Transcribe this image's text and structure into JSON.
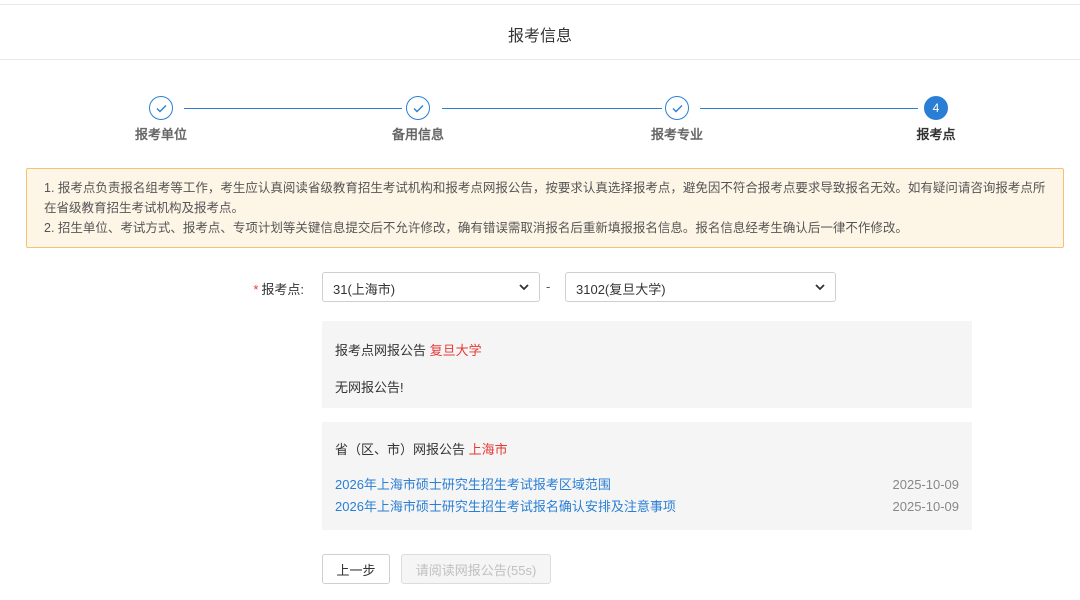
{
  "header": {
    "title": "报考信息"
  },
  "steps": [
    {
      "label": "报考单位",
      "status": "done",
      "icon": "check-icon"
    },
    {
      "label": "备用信息",
      "status": "done",
      "icon": "check-icon"
    },
    {
      "label": "报考专业",
      "status": "done",
      "icon": "check-icon"
    },
    {
      "label": "报考点",
      "status": "active",
      "number": "4"
    }
  ],
  "notice": {
    "line1": "1. 报考点负责报名组考等工作，考生应认真阅读省级教育招生考试机构和报考点网报公告，按要求认真选择报考点，避免因不符合报考点要求导致报名无效。如有疑问请咨询报考点所在省级教育招生考试机构及报考点。",
    "line2": "2. 招生单位、考试方式、报考点、专项计划等关键信息提交后不允许修改，确有错误需取消报名后重新填报报名信息。报名信息经考生确认后一律不作修改。"
  },
  "form": {
    "required_mark": "*",
    "label": "报考点:",
    "province_select": "31(上海市)",
    "separator": "-",
    "site_select": "3102(复旦大学)"
  },
  "site_notice": {
    "title": "报考点网报公告",
    "highlight": "复旦大学",
    "empty_text": "无网报公告!"
  },
  "province_notice": {
    "title": "省（区、市）网报公告",
    "highlight": "上海市",
    "items": [
      {
        "title": "2026年上海市硕士研究生招生考试报考区域范围",
        "date": "2025-10-09"
      },
      {
        "title": "2026年上海市硕士研究生招生考试报名确认安排及注意事项",
        "date": "2025-10-09"
      }
    ]
  },
  "buttons": {
    "prev": "上一步",
    "next": "请阅读网报公告(55s)"
  },
  "colors": {
    "accent": "#2a7fd4",
    "highlight": "#e53935",
    "notice_bg": "#fdf6e7",
    "notice_border": "#f2c374"
  }
}
